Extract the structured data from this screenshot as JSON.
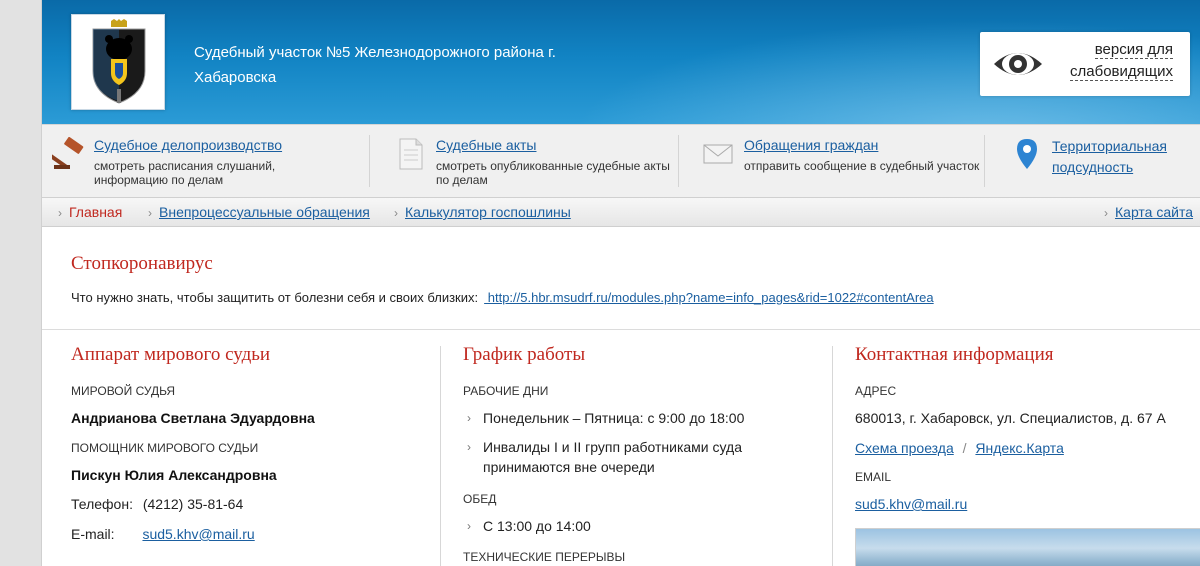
{
  "header": {
    "title": "Судебный участок №5 Железнодорожного района г. Хабаровска",
    "vision_label": "версия для слабовидящих",
    "emblem_icon": "khabarovsk-krai-emblem",
    "colors": {
      "primary": "#1183c3",
      "accent_red": "#c0281f",
      "link": "#1b5fa0"
    }
  },
  "services": [
    {
      "title": "Судебное делопроизводство",
      "desc": "смотреть расписания слушаний, информацию по делам",
      "icon": "gavel-icon"
    },
    {
      "title": "Судебные акты",
      "desc": "смотреть опубликованные судебные акты по делам",
      "icon": "document-icon"
    },
    {
      "title": "Обращения граждан",
      "desc": "отправить сообщение в судебный участок",
      "icon": "envelope-icon"
    },
    {
      "title": "Территориальная подсудность",
      "desc": "",
      "icon": "map-pin-icon"
    }
  ],
  "nav": {
    "items": [
      "Главная",
      "Внепроцессуальные обращения",
      "Калькулятор госпошлины"
    ],
    "sitemap": "Карта сайта"
  },
  "news": {
    "title": "Стопкоронавирус",
    "text": "Что нужно знать, чтобы защитить от болезни себя и своих близких:",
    "link": " http://5.hbr.msudrf.ru/modules.php?name=info_pages&rid=1022#contentArea"
  },
  "apparatus": {
    "title": "Аппарат мирового судьи",
    "judge_label": "МИРОВОЙ СУДЬЯ",
    "judge_name": "Андрианова Светлана Эдуардовна",
    "assistant_label": "ПОМОЩНИК МИРОВОГО СУДЬИ",
    "assistant_name": "Пискун Юлия Александровна",
    "phone_label": "Телефон:",
    "phone": "(4212) 35-81-64",
    "email_label": "E-mail:",
    "email": "sud5.khv@mail.ru"
  },
  "schedule": {
    "title": "График работы",
    "workdays_label": "РАБОЧИЕ ДНИ",
    "workdays": [
      "Понедельник – Пятница: с 9:00 до 18:00",
      "Инвалиды I и II групп работниками суда принимаются вне очереди"
    ],
    "lunch_label": "ОБЕД",
    "lunch": "С 13:00 до 14:00",
    "breaks_label": "ТЕХНИЧЕСКИЕ ПЕРЕРЫВЫ"
  },
  "contacts": {
    "title": "Контактная информация",
    "address_label": "АДРЕС",
    "address": "680013, г. Хабаровск, ул. Специалистов, д. 67 А",
    "route_link": "Схема проезда",
    "separator": "/",
    "yandex_link": "Яндекс.Карта",
    "email_label": "EMAIL",
    "email": "sud5.khv@mail.ru"
  }
}
